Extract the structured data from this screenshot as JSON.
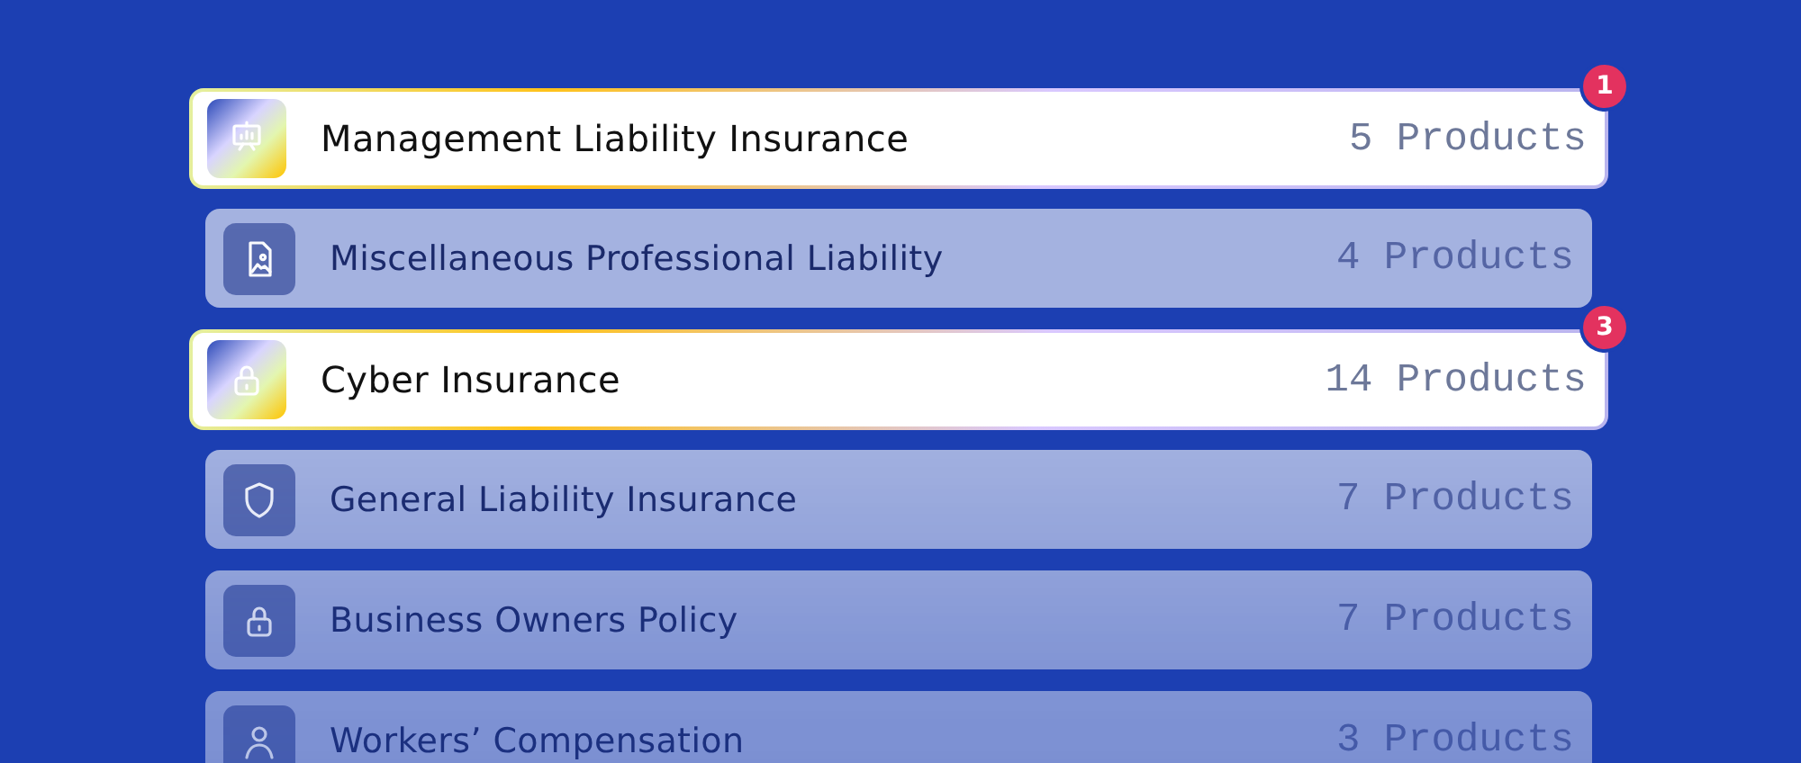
{
  "categories": [
    {
      "kind": "presentation",
      "name": "Management Liability Insurance",
      "count": "5 Products",
      "selected": true,
      "badge": "1"
    },
    {
      "kind": "document",
      "name": "Miscellaneous Professional Liability",
      "count": "4 Products",
      "selected": false
    },
    {
      "kind": "lock",
      "name": "Cyber Insurance",
      "count": "14 Products",
      "selected": true,
      "badge": "3"
    },
    {
      "kind": "shield",
      "name": "General Liability Insurance",
      "count": "7 Products",
      "selected": false
    },
    {
      "kind": "lock",
      "name": "Business Owners Policy",
      "count": "7 Products",
      "selected": false
    },
    {
      "kind": "person",
      "name": "Workers’ Compensation",
      "count": "3 Products",
      "selected": false
    }
  ]
}
